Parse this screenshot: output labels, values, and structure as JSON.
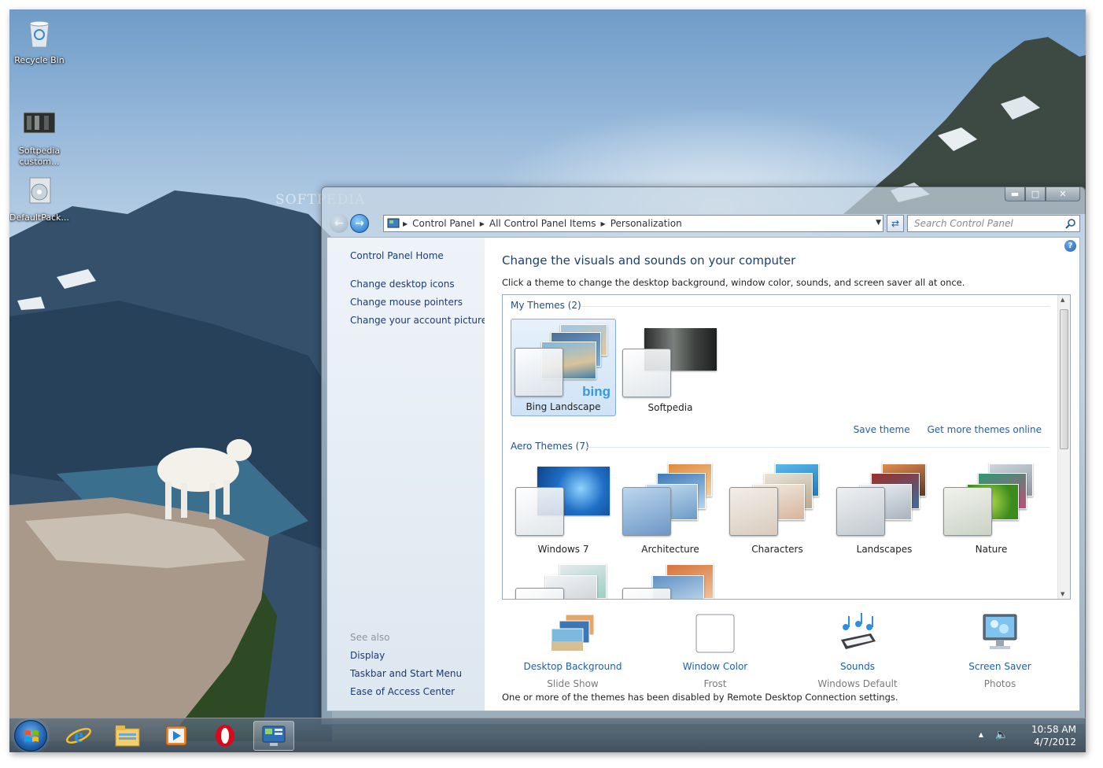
{
  "desktop": {
    "icons": [
      {
        "label": "Recycle Bin",
        "icon": "recycle-bin-icon"
      },
      {
        "label": "Softpedia custom...",
        "icon": "theme-pack-icon"
      },
      {
        "label": "DefaultPack...",
        "icon": "package-icon"
      }
    ],
    "watermark": "SOFTPEDIA"
  },
  "window": {
    "address": {
      "crumbs": [
        "Control Panel",
        "All Control Panel Items",
        "Personalization"
      ]
    },
    "search": {
      "placeholder": "Search Control Panel"
    },
    "left_pane": {
      "home": "Control Panel Home",
      "links": [
        "Change desktop icons",
        "Change mouse pointers",
        "Change your account picture"
      ],
      "see_also_title": "See also",
      "see_also": [
        "Display",
        "Taskbar and Start Menu",
        "Ease of Access Center"
      ]
    },
    "main": {
      "title": "Change the visuals and sounds on your computer",
      "description": "Click a theme to change the desktop background, window color, sounds, and screen saver all at once.",
      "my_themes_title": "My Themes (2)",
      "my_themes": [
        {
          "name": "Bing Landscape",
          "selected": true
        },
        {
          "name": "Softpedia",
          "selected": false
        }
      ],
      "save_theme": "Save theme",
      "get_more": "Get more themes online",
      "aero_themes_title": "Aero Themes (7)",
      "aero_themes": [
        "Windows 7",
        "Architecture",
        "Characters",
        "Landscapes",
        "Nature"
      ],
      "bottom": [
        {
          "label": "Desktop Background",
          "sub": "Slide Show",
          "icon": "desktop-background-icon"
        },
        {
          "label": "Window Color",
          "sub": "Frost",
          "icon": "window-color-icon"
        },
        {
          "label": "Sounds",
          "sub": "Windows Default",
          "icon": "sounds-icon"
        },
        {
          "label": "Screen Saver",
          "sub": "Photos",
          "icon": "screen-saver-icon"
        }
      ],
      "footnote": "One or more of the themes has been disabled by Remote Desktop Connection settings."
    }
  },
  "taskbar": {
    "buttons": [
      "internet-explorer-icon",
      "windows-explorer-icon",
      "media-player-icon",
      "opera-icon",
      "control-panel-icon"
    ],
    "clock": {
      "time": "10:58 AM",
      "date": "4/7/2012"
    }
  },
  "colors": {
    "link": "#1e5fae",
    "heading": "#1e3e6e",
    "accent": "#3a9ad9"
  }
}
